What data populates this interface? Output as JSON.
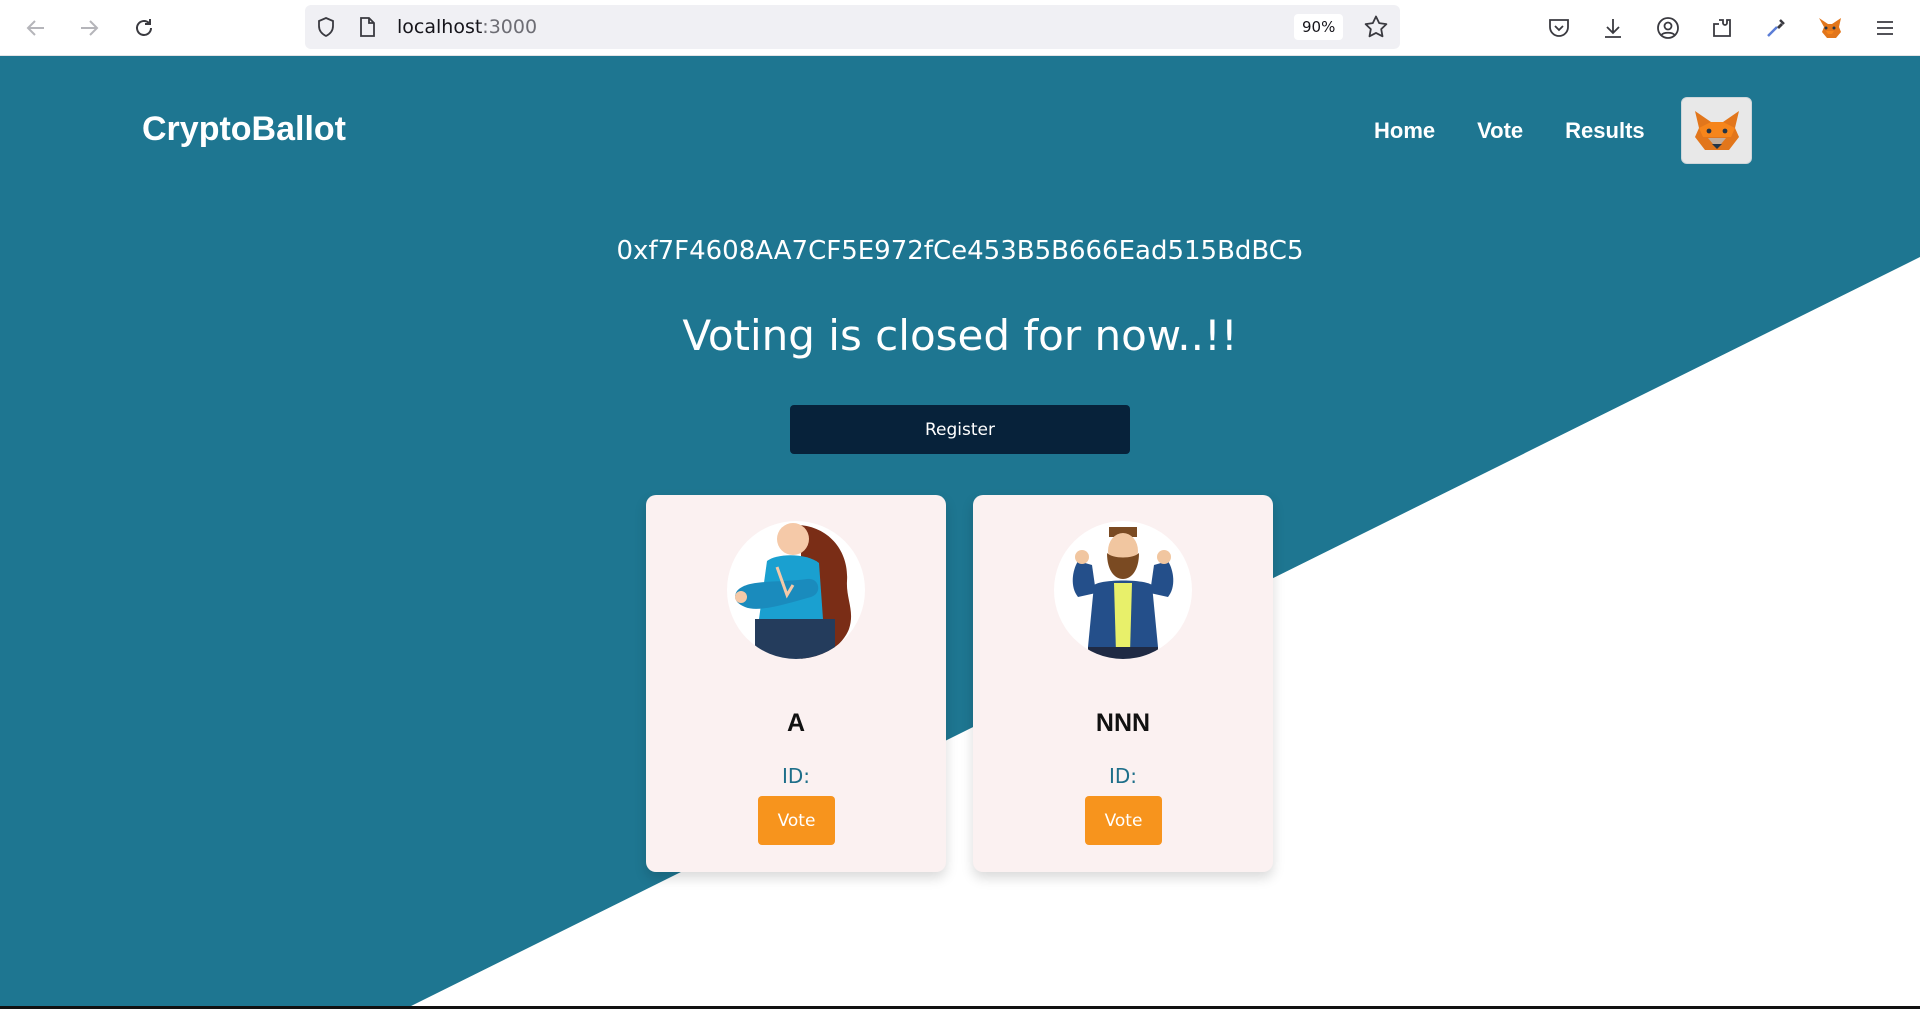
{
  "browser": {
    "url_host": "localhost",
    "url_port": ":3000",
    "zoom": "90%"
  },
  "site": {
    "brand": "CryptoBallot",
    "nav": [
      "Home",
      "Vote",
      "Results"
    ],
    "colors": {
      "primary": "#1e7691",
      "dark": "#07223a",
      "accent": "#f7941d",
      "card": "#fbf1f1"
    }
  },
  "main": {
    "address": "0xf7F4608AA7CF5E972fCe453B5B666Ead515BdBC5",
    "status": "Voting is closed for now..!!",
    "register_label": "Register"
  },
  "candidates": [
    {
      "name": "A",
      "id_label": "ID:",
      "vote_label": "Vote",
      "avatar": "woman-crossed-arms-avatar"
    },
    {
      "name": "NNN",
      "id_label": "ID:",
      "vote_label": "Vote",
      "avatar": "bearded-man-thumbs-up-avatar"
    }
  ]
}
